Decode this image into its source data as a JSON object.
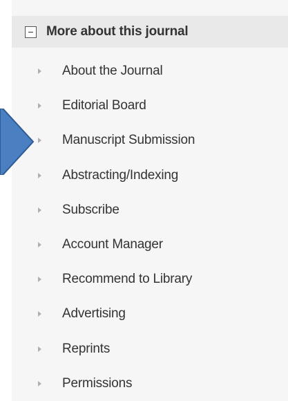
{
  "panel": {
    "title": "More about this journal",
    "toggle_icon": "collapse-minus-icon"
  },
  "nav": {
    "items": [
      {
        "label": "About the Journal"
      },
      {
        "label": "Editorial Board"
      },
      {
        "label": "Manuscript Submission"
      },
      {
        "label": "Abstracting/Indexing"
      },
      {
        "label": "Subscribe"
      },
      {
        "label": "Account Manager"
      },
      {
        "label": "Recommend to Library"
      },
      {
        "label": "Advertising"
      },
      {
        "label": "Reprints"
      },
      {
        "label": "Permissions"
      }
    ],
    "arrow_icon": "triangle-right-icon"
  },
  "annotation": {
    "icon": "pointer-arrow-icon",
    "fill": "#4a7fc1",
    "stroke": "#2f5a94",
    "highlighted_item": "Manuscript Submission"
  }
}
